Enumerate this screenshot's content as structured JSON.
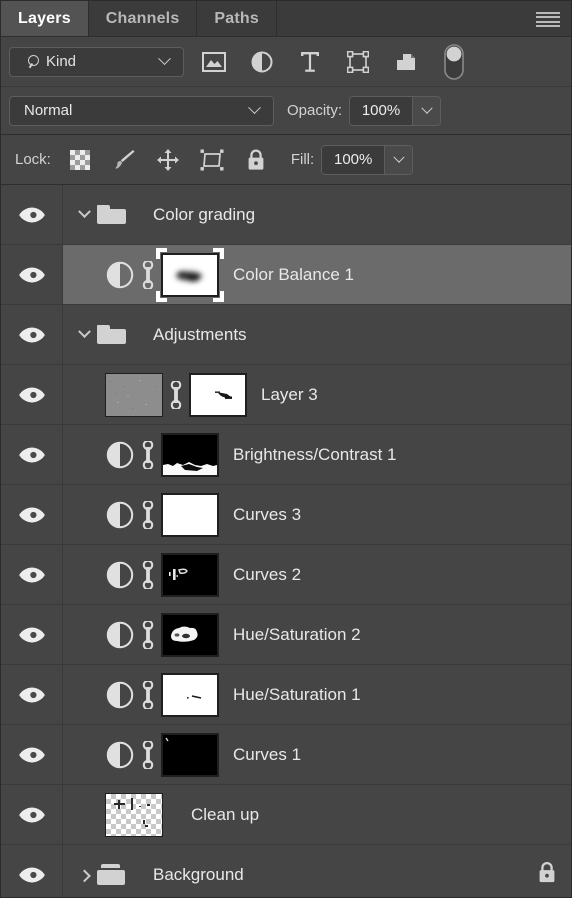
{
  "panel": {
    "tabs": [
      {
        "label": "Layers",
        "active": true
      },
      {
        "label": "Channels",
        "active": false
      },
      {
        "label": "Paths",
        "active": false
      }
    ],
    "menu_icon": "hamburger-menu-icon"
  },
  "filter": {
    "kind_label": "Kind",
    "search_icon": "magnifier-icon",
    "dropdown_icon": "chevron-down-icon",
    "type_filters": [
      {
        "name": "pixel-layers-filter",
        "icon": "image-icon"
      },
      {
        "name": "adjustment-layers-filter",
        "icon": "adjustment-circle-icon"
      },
      {
        "name": "type-layers-filter",
        "icon": "text-t-icon"
      },
      {
        "name": "shape-layers-filter",
        "icon": "vector-shape-icon"
      },
      {
        "name": "smart-object-filter",
        "icon": "smart-object-icon"
      }
    ],
    "toggle": {
      "name": "filter-enable-toggle",
      "state": "on"
    }
  },
  "blend": {
    "mode": "Normal",
    "opacity_label": "Opacity:",
    "opacity_value": "100%",
    "dropdown_icon": "chevron-down-icon"
  },
  "lock": {
    "label": "Lock:",
    "buttons": [
      {
        "name": "lock-transparent-pixels",
        "icon": "checkerboard-icon"
      },
      {
        "name": "lock-image-pixels",
        "icon": "brush-icon"
      },
      {
        "name": "lock-position",
        "icon": "move-arrows-icon"
      },
      {
        "name": "lock-artboard-nesting",
        "icon": "artboard-icon"
      },
      {
        "name": "lock-all",
        "icon": "padlock-icon"
      }
    ],
    "fill_label": "Fill:",
    "fill_value": "100%"
  },
  "layers": [
    {
      "name": "Color grading",
      "type": "group",
      "expanded": true,
      "visible": true,
      "selected": false,
      "indent": 0
    },
    {
      "name": "Color Balance 1",
      "type": "adjustment",
      "visible": true,
      "selected": true,
      "indent": 1,
      "has_mask": true,
      "mask_style": "white-with-dark-blob",
      "linked": true
    },
    {
      "name": "Adjustments",
      "type": "group",
      "expanded": true,
      "visible": true,
      "selected": false,
      "indent": 0
    },
    {
      "name": "Layer 3",
      "type": "pixel",
      "visible": true,
      "selected": false,
      "indent": 1,
      "thumb_style": "gray-noise",
      "has_mask": true,
      "mask_style": "white-with-small-dark-streak",
      "linked": true
    },
    {
      "name": "Brightness/Contrast 1",
      "type": "adjustment",
      "visible": true,
      "selected": false,
      "indent": 1,
      "has_mask": true,
      "mask_style": "black-top-white-bottom",
      "linked": true
    },
    {
      "name": "Curves 3",
      "type": "adjustment",
      "visible": true,
      "selected": false,
      "indent": 1,
      "has_mask": true,
      "mask_style": "all-white",
      "linked": true
    },
    {
      "name": "Curves 2",
      "type": "adjustment",
      "visible": true,
      "selected": false,
      "indent": 1,
      "has_mask": true,
      "mask_style": "black-with-small-white-marks",
      "linked": true
    },
    {
      "name": "Hue/Saturation 2",
      "type": "adjustment",
      "visible": true,
      "selected": false,
      "indent": 1,
      "has_mask": true,
      "mask_style": "black-with-white-blob",
      "linked": true
    },
    {
      "name": "Hue/Saturation 1",
      "type": "adjustment",
      "visible": true,
      "selected": false,
      "indent": 1,
      "has_mask": true,
      "mask_style": "white-with-tiny-dark-mark",
      "linked": true
    },
    {
      "name": "Curves 1",
      "type": "adjustment",
      "visible": true,
      "selected": false,
      "indent": 1,
      "has_mask": true,
      "mask_style": "black-with-corner-speck",
      "linked": true
    },
    {
      "name": "Clean up",
      "type": "pixel",
      "visible": true,
      "selected": false,
      "indent": 1,
      "thumb_style": "transparent-checker",
      "has_mask": false,
      "linked": false
    },
    {
      "name": "Background",
      "type": "group",
      "expanded": false,
      "visible": true,
      "selected": false,
      "indent": 0,
      "locked": true,
      "lock_icon": "padlock-icon"
    }
  ],
  "colors": {
    "panel_bg": "#454545",
    "tabbar_bg": "#3b3b3b",
    "active_tab_bg": "#535353",
    "selected_row_bg": "#6b6b6b",
    "text": "#e8e8e8",
    "icon": "#d2d2d2",
    "field_bg": "#3b3b3b",
    "border": "#2e2e2e"
  }
}
